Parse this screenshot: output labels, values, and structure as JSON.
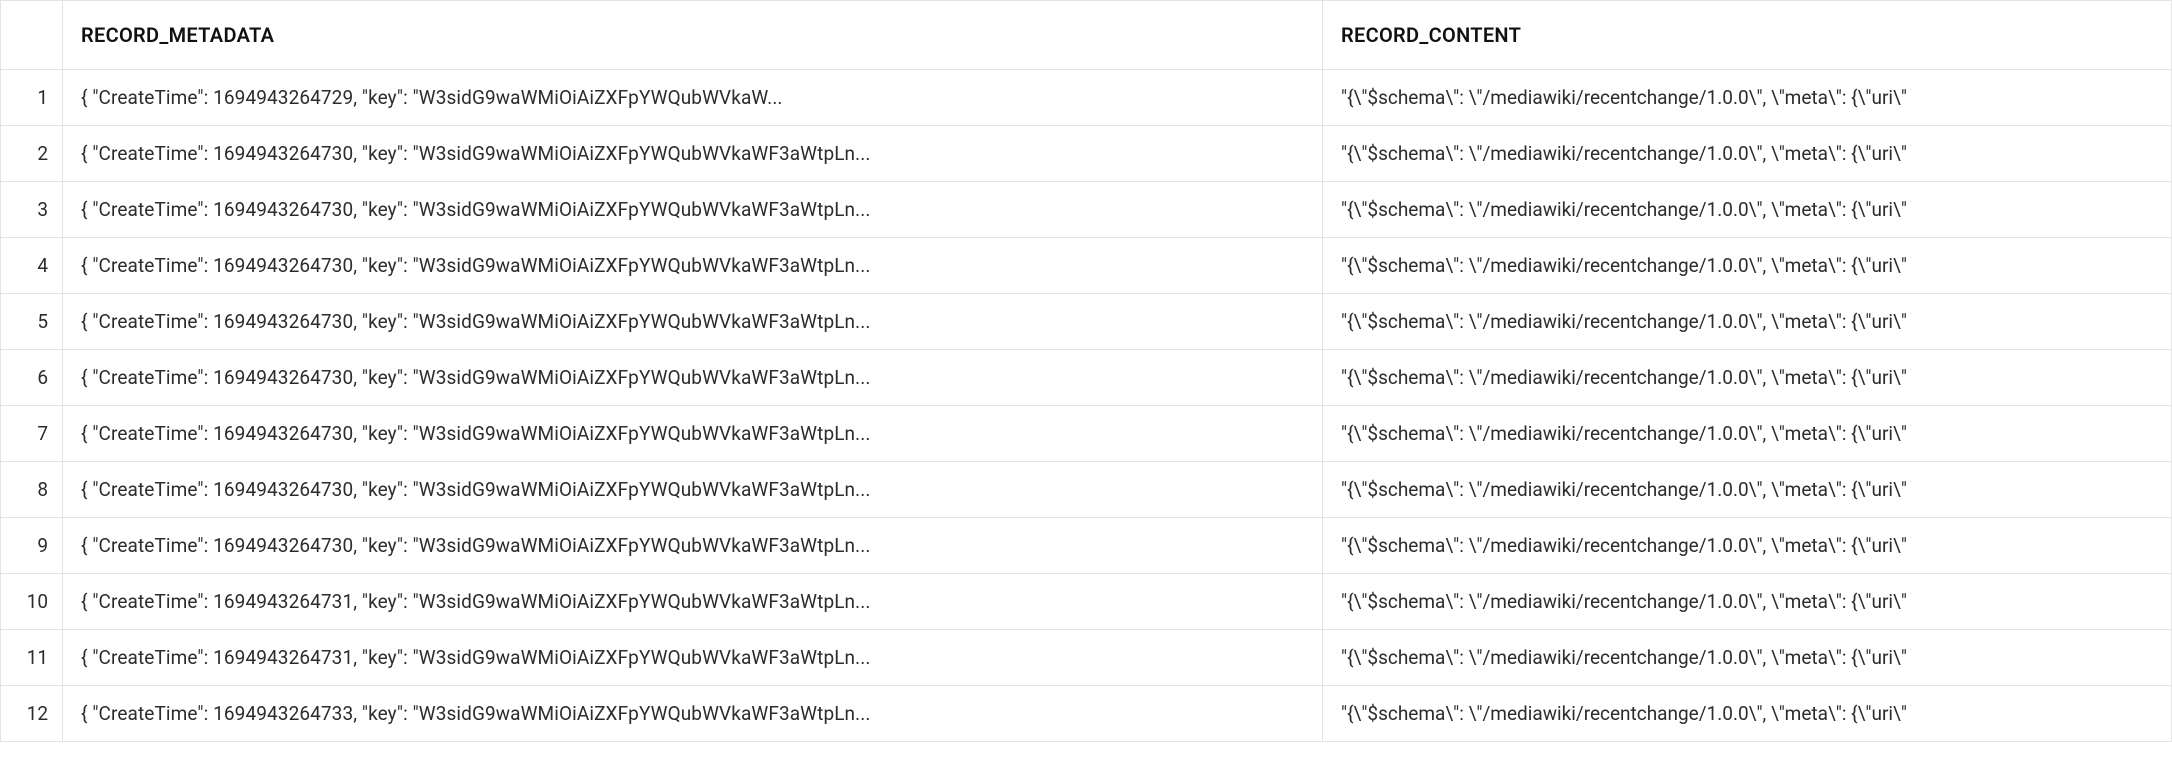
{
  "headers": {
    "metadata": "RECORD_METADATA",
    "content": "RECORD_CONTENT"
  },
  "rows": [
    {
      "num": "1",
      "metadata": "{   \"CreateTime\": 1694943264729,   \"key\": \"W3sidG9waWMiOiAiZXFpYWQubWVkaW...",
      "content": "\"{\\\"$schema\\\": \\\"/mediawiki/recentchange/1.0.0\\\", \\\"meta\\\": {\\\"uri\\\""
    },
    {
      "num": "2",
      "metadata": "{   \"CreateTime\": 1694943264730,   \"key\": \"W3sidG9waWMiOiAiZXFpYWQubWVkaWF3aWtpLn...",
      "content": "\"{\\\"$schema\\\": \\\"/mediawiki/recentchange/1.0.0\\\", \\\"meta\\\": {\\\"uri\\\""
    },
    {
      "num": "3",
      "metadata": "{   \"CreateTime\": 1694943264730,   \"key\": \"W3sidG9waWMiOiAiZXFpYWQubWVkaWF3aWtpLn...",
      "content": "\"{\\\"$schema\\\": \\\"/mediawiki/recentchange/1.0.0\\\", \\\"meta\\\": {\\\"uri\\\""
    },
    {
      "num": "4",
      "metadata": "{   \"CreateTime\": 1694943264730,   \"key\": \"W3sidG9waWMiOiAiZXFpYWQubWVkaWF3aWtpLn...",
      "content": "\"{\\\"$schema\\\": \\\"/mediawiki/recentchange/1.0.0\\\", \\\"meta\\\": {\\\"uri\\\""
    },
    {
      "num": "5",
      "metadata": "{   \"CreateTime\": 1694943264730,   \"key\": \"W3sidG9waWMiOiAiZXFpYWQubWVkaWF3aWtpLn...",
      "content": "\"{\\\"$schema\\\": \\\"/mediawiki/recentchange/1.0.0\\\", \\\"meta\\\": {\\\"uri\\\""
    },
    {
      "num": "6",
      "metadata": "{   \"CreateTime\": 1694943264730,   \"key\": \"W3sidG9waWMiOiAiZXFpYWQubWVkaWF3aWtpLn...",
      "content": "\"{\\\"$schema\\\": \\\"/mediawiki/recentchange/1.0.0\\\", \\\"meta\\\": {\\\"uri\\\""
    },
    {
      "num": "7",
      "metadata": "{   \"CreateTime\": 1694943264730,   \"key\": \"W3sidG9waWMiOiAiZXFpYWQubWVkaWF3aWtpLn...",
      "content": "\"{\\\"$schema\\\": \\\"/mediawiki/recentchange/1.0.0\\\", \\\"meta\\\": {\\\"uri\\\""
    },
    {
      "num": "8",
      "metadata": "{   \"CreateTime\": 1694943264730,   \"key\": \"W3sidG9waWMiOiAiZXFpYWQubWVkaWF3aWtpLn...",
      "content": "\"{\\\"$schema\\\": \\\"/mediawiki/recentchange/1.0.0\\\", \\\"meta\\\": {\\\"uri\\\""
    },
    {
      "num": "9",
      "metadata": "{   \"CreateTime\": 1694943264730,   \"key\": \"W3sidG9waWMiOiAiZXFpYWQubWVkaWF3aWtpLn...",
      "content": "\"{\\\"$schema\\\": \\\"/mediawiki/recentchange/1.0.0\\\", \\\"meta\\\": {\\\"uri\\\""
    },
    {
      "num": "10",
      "metadata": "{   \"CreateTime\": 1694943264731,   \"key\": \"W3sidG9waWMiOiAiZXFpYWQubWVkaWF3aWtpLn...",
      "content": "\"{\\\"$schema\\\": \\\"/mediawiki/recentchange/1.0.0\\\", \\\"meta\\\": {\\\"uri\\\""
    },
    {
      "num": "11",
      "metadata": "{   \"CreateTime\": 1694943264731,   \"key\": \"W3sidG9waWMiOiAiZXFpYWQubWVkaWF3aWtpLn...",
      "content": "\"{\\\"$schema\\\": \\\"/mediawiki/recentchange/1.0.0\\\", \\\"meta\\\": {\\\"uri\\\""
    },
    {
      "num": "12",
      "metadata": "{   \"CreateTime\": 1694943264733,   \"key\": \"W3sidG9waWMiOiAiZXFpYWQubWVkaWF3aWtpLn...",
      "content": "\"{\\\"$schema\\\": \\\"/mediawiki/recentchange/1.0.0\\\", \\\"meta\\\": {\\\"uri\\\""
    }
  ]
}
